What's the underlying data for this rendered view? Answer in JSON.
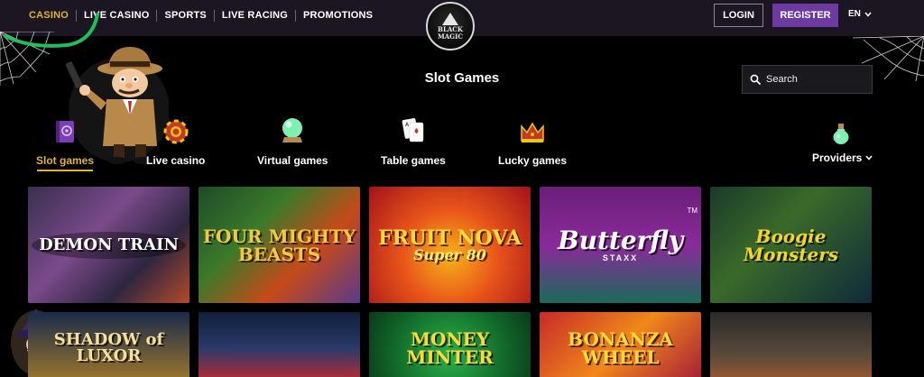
{
  "nav": {
    "items": [
      "CASINO",
      "LIVE CASINO",
      "SPORTS",
      "LIVE RACING",
      "PROMOTIONS"
    ],
    "login_label": "LOGIN",
    "register_label": "REGISTER",
    "language": "EN"
  },
  "logo": {
    "line1": "BLACK",
    "line2": "MAGIC"
  },
  "page": {
    "title": "Slot Games"
  },
  "search": {
    "placeholder": "Search"
  },
  "categories": [
    {
      "label": "Slot games",
      "icon": "spellbook-icon"
    },
    {
      "label": "Live casino",
      "icon": "chip-icon"
    },
    {
      "label": "Virtual games",
      "icon": "crystal-ball-icon"
    },
    {
      "label": "Table games",
      "icon": "cards-icon"
    },
    {
      "label": "Lucky games",
      "icon": "crown-icon"
    }
  ],
  "providers_label": "Providers",
  "games": [
    {
      "title": "DEMON TRAIN"
    },
    {
      "title": "FOUR MIGHTY BEASTS"
    },
    {
      "title": "FRUIT NOVA",
      "subtitle": "Super 80"
    },
    {
      "title": "Butterfly",
      "subtitle": "STAXX",
      "tm": "TM"
    },
    {
      "title": "Boogie Monsters"
    },
    {
      "title": "SHADOW of LUXOR"
    },
    {
      "title": ""
    },
    {
      "title": "MONEY MINTER"
    },
    {
      "title": "BONANZA WHEEL"
    },
    {
      "title": ""
    }
  ],
  "colors": {
    "accent_gold": "#e0b23b",
    "register_purple": "#6d3aa2",
    "topbar_bg": "#1c1622",
    "page_bg": "#000000"
  }
}
